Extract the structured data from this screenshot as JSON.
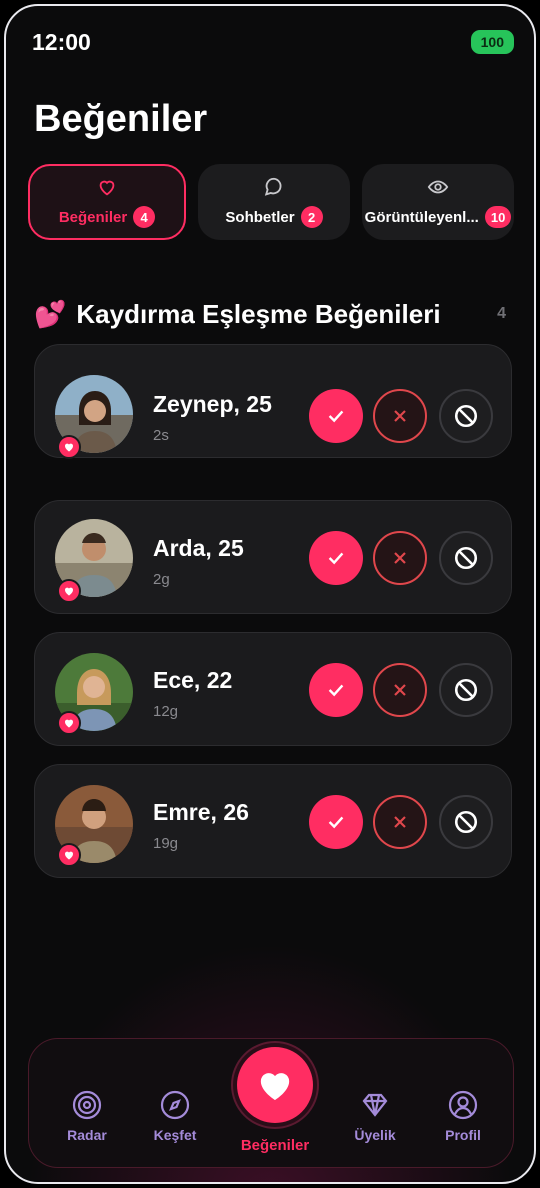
{
  "status": {
    "time": "12:00",
    "battery": "100"
  },
  "page": {
    "title": "Beğeniler"
  },
  "tabs": [
    {
      "label": "Beğeniler",
      "count": "4",
      "icon": "heart-icon",
      "active": true
    },
    {
      "label": "Sohbetler",
      "count": "2",
      "icon": "chat-bubble-icon",
      "active": false
    },
    {
      "label": "Görüntüleyenl...",
      "count": "10",
      "icon": "eye-icon",
      "active": false
    }
  ],
  "section": {
    "emoji": "💕",
    "title": "Kaydırma Eşleşme Beğenileri",
    "count": "4"
  },
  "likes": [
    {
      "name": "Zeynep, 25",
      "ago": "2s"
    },
    {
      "name": "Arda, 25",
      "ago": "2g"
    },
    {
      "name": "Ece, 22",
      "ago": "12g"
    },
    {
      "name": "Emre, 26",
      "ago": "19g"
    }
  ],
  "nav": {
    "items": [
      {
        "label": "Radar",
        "icon": "radar-icon"
      },
      {
        "label": "Keşfet",
        "icon": "compass-icon"
      },
      {
        "label": "Beğeniler",
        "icon": "heart-icon"
      },
      {
        "label": "Üyelik",
        "icon": "diamond-icon"
      },
      {
        "label": "Profil",
        "icon": "user-circle-icon"
      }
    ]
  },
  "colors": {
    "accent": "#ff2d62",
    "background": "#0b0b0c",
    "card": "#1b1b1d",
    "nav_icon": "#a48bd9",
    "battery": "#27c45a"
  }
}
